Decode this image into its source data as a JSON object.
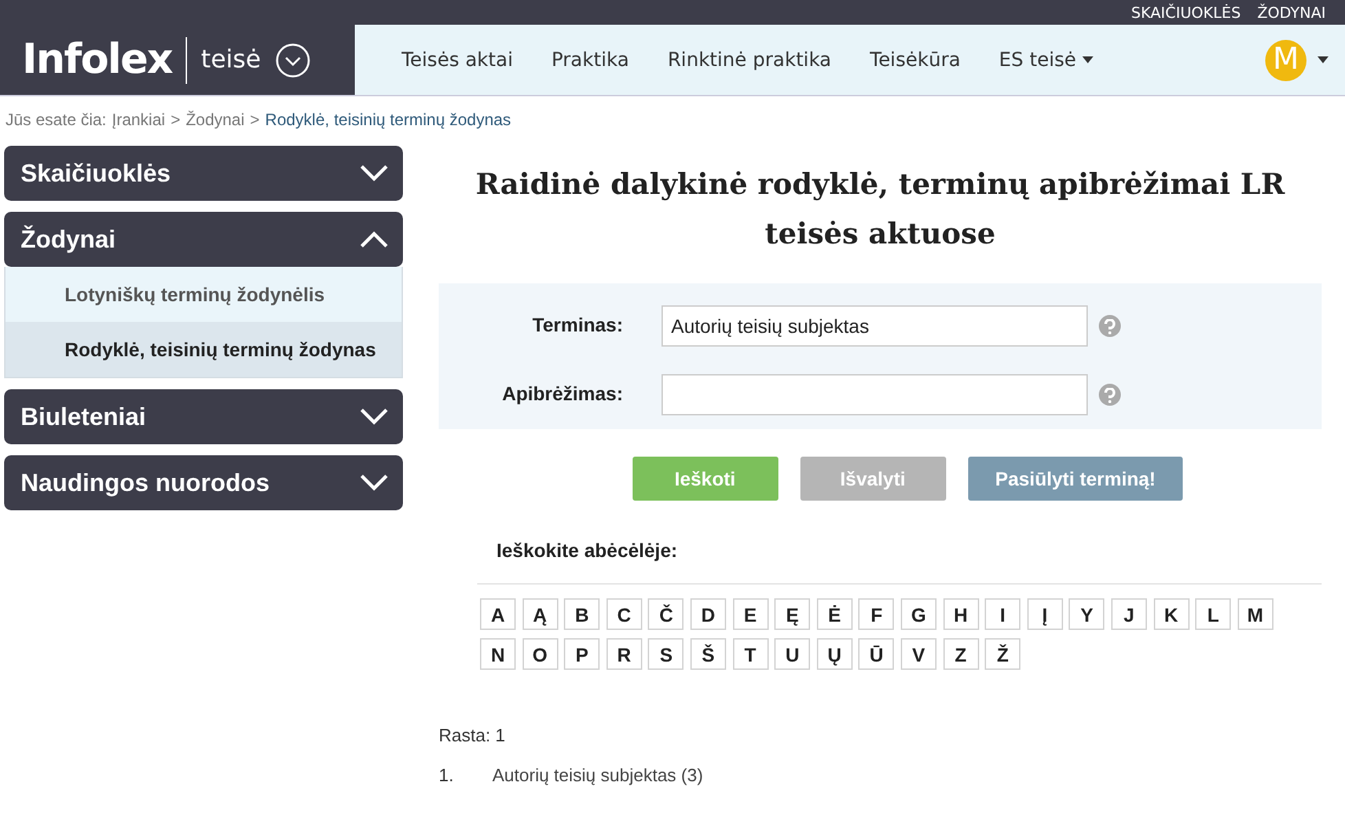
{
  "top_links": [
    "SKAIČIUOKLĖS",
    "ŽODYNAI"
  ],
  "logo": {
    "brand": "Infolex",
    "section": "teisė"
  },
  "nav": [
    {
      "label": "Teisės aktai",
      "dropdown": false
    },
    {
      "label": "Praktika",
      "dropdown": false
    },
    {
      "label": "Rinktinė praktika",
      "dropdown": false
    },
    {
      "label": "Teisėkūra",
      "dropdown": false
    },
    {
      "label": "ES teisė",
      "dropdown": true
    }
  ],
  "user": {
    "initial": "M"
  },
  "breadcrumb": {
    "prefix": "Jūs esate čia:",
    "separator": ">",
    "items": [
      {
        "label": "Įrankiai",
        "selected": false
      },
      {
        "label": "Žodynai",
        "selected": false
      },
      {
        "label": "Rodyklė, teisinių terminų žodynas",
        "selected": true
      }
    ]
  },
  "sidebar": [
    {
      "label": "Skaičiuoklės",
      "expanded": false
    },
    {
      "label": "Žodynai",
      "expanded": true,
      "children": [
        {
          "label": "Lotyniškų terminų žodynėlis",
          "selected": false
        },
        {
          "label": "Rodyklė, teisinių terminų žodynas",
          "selected": true
        }
      ]
    },
    {
      "label": "Biuleteniai",
      "expanded": false
    },
    {
      "label": "Naudingos nuorodos",
      "expanded": false
    }
  ],
  "title": "Raidinė dalykinė rodyklė, terminų apibrėžimai LR teisės aktuose",
  "fields": [
    {
      "label": "Terminas:",
      "value": "Autorių teisių subjektas"
    },
    {
      "label": "Apibrėžimas:"
    }
  ],
  "buttons": [
    {
      "label": "Ieškoti",
      "kind": "primary"
    },
    {
      "label": "Išvalyti",
      "kind": "secondary"
    },
    {
      "label": "Pasiūlyti terminą!",
      "kind": "info"
    }
  ],
  "alphabet_label": "Ieškokite abėcėlėje:",
  "letters": [
    "A",
    "Ą",
    "B",
    "C",
    "Č",
    "D",
    "E",
    "Ę",
    "Ė",
    "F",
    "G",
    "H",
    "I",
    "Į",
    "Y",
    "J",
    "K",
    "L",
    "M",
    "N",
    "O",
    "P",
    "R",
    "S",
    "Š",
    "T",
    "U",
    "Ų",
    "Ū",
    "V",
    "Z",
    "Ž"
  ],
  "results": {
    "count_text": "Rasta: 1",
    "items": [
      {
        "number": "1.",
        "label": "Autorių teisių subjektas (3)"
      }
    ]
  }
}
